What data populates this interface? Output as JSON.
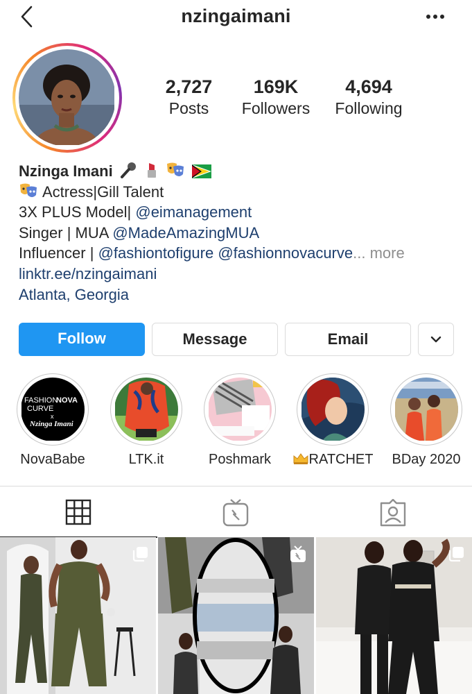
{
  "header": {
    "username": "nzingaimani",
    "back_icon": "chevron-left-icon",
    "more_icon": "more-horizontal-icon"
  },
  "profile": {
    "stats": {
      "posts_count": "2,727",
      "posts_label": "Posts",
      "followers_count": "169K",
      "followers_label": "Followers",
      "following_count": "4,694",
      "following_label": "Following"
    },
    "ring_colors": [
      "#f58529",
      "#dd2a7b",
      "#8134af"
    ]
  },
  "bio": {
    "name": "Nzinga Imani",
    "name_emojis": [
      "microphone-icon",
      "lipstick-icon",
      "performing-arts-icon",
      "guyana-flag-icon"
    ],
    "line1_text": "Actress|Gill Talent",
    "line2_text": "3X PLUS Model| ",
    "line2_mention": "@eimanagement",
    "line3_text": "Singer | MUA ",
    "line3_mention": "@MadeAmazingMUA",
    "line4_text": "Influencer | ",
    "line4_mention1": "@fashiontofigure",
    "line4_mention2": "@fashionnovacurve",
    "line4_ellipsis": "...",
    "line4_more": "more",
    "website": "linktr.ee/nzingaimani",
    "location": "Atlanta, Georgia"
  },
  "actions": {
    "follow_label": "Follow",
    "message_label": "Message",
    "email_label": "Email",
    "dropdown_icon": "chevron-down-icon",
    "follow_color": "#1f96f2"
  },
  "highlights": [
    {
      "label": "NovaBabe",
      "cover_text_1": "FASHION",
      "cover_text_2": "NOVA",
      "cover_text_3": "CURVE",
      "cover_text_4": "x",
      "cover_text_5": "Nzinga Imani"
    },
    {
      "label": "LTK.it"
    },
    {
      "label": "Poshmark"
    },
    {
      "label": "RATCHET",
      "icon": "crown-icon"
    },
    {
      "label": "BDay 2020"
    }
  ],
  "tabs": [
    {
      "name": "grid",
      "icon": "grid-icon",
      "active": true
    },
    {
      "name": "igtv",
      "icon": "igtv-icon",
      "active": false
    },
    {
      "name": "tagged",
      "icon": "tagged-person-icon",
      "active": false
    }
  ],
  "posts": [
    {
      "badge_icon": "multiple-posts-icon"
    },
    {
      "badge_icon": "igtv-badge-icon"
    },
    {
      "badge_icon": "multiple-posts-icon"
    }
  ]
}
